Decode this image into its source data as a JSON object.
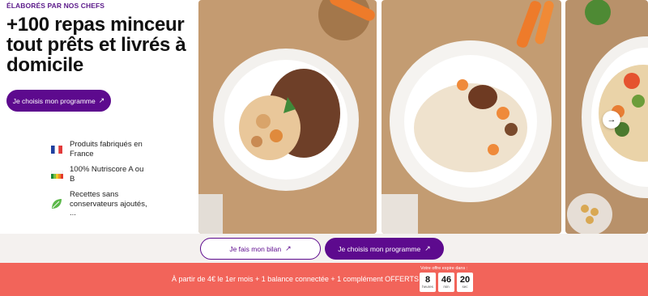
{
  "hero": {
    "eyebrow": "ÉLABORÉS PAR NOS CHEFS",
    "headline": "+100 repas minceur tout prêts et livrés à domicile",
    "cta_label": "Je choisis mon programme",
    "cta_arrow": "↗"
  },
  "features": [
    {
      "icon": "france-flag-icon",
      "label": "Produits fabriqués en France"
    },
    {
      "icon": "nutriscore-icon",
      "label": "100% Nutriscore A ou B"
    },
    {
      "icon": "leaf-icon",
      "label": "Recettes sans conservateurs ajoutés, ..."
    }
  ],
  "gallery": {
    "photos": [
      {
        "icon": "meal-chicken-lentils-photo"
      },
      {
        "icon": "meal-rice-mushrooms-photo"
      },
      {
        "icon": "meal-vegetables-couscous-photo"
      }
    ],
    "next_icon": "→"
  },
  "actions": {
    "bilan_label": "Je fais mon bilan",
    "programme_label": "Je choisis mon programme",
    "arrow": "↗"
  },
  "promo": {
    "text": "À partir de 4€ le 1er mois + 1 balance connectée + 1 complément OFFERTS",
    "expiry_label": "Votre offre expire dans :",
    "timer": [
      {
        "value": "8",
        "unit": "heures"
      },
      {
        "value": "46",
        "unit": "min"
      },
      {
        "value": "20",
        "unit": "sec"
      }
    ]
  },
  "colors": {
    "brand_purple": "#5d0a8e",
    "promo_red": "#f2645a"
  }
}
